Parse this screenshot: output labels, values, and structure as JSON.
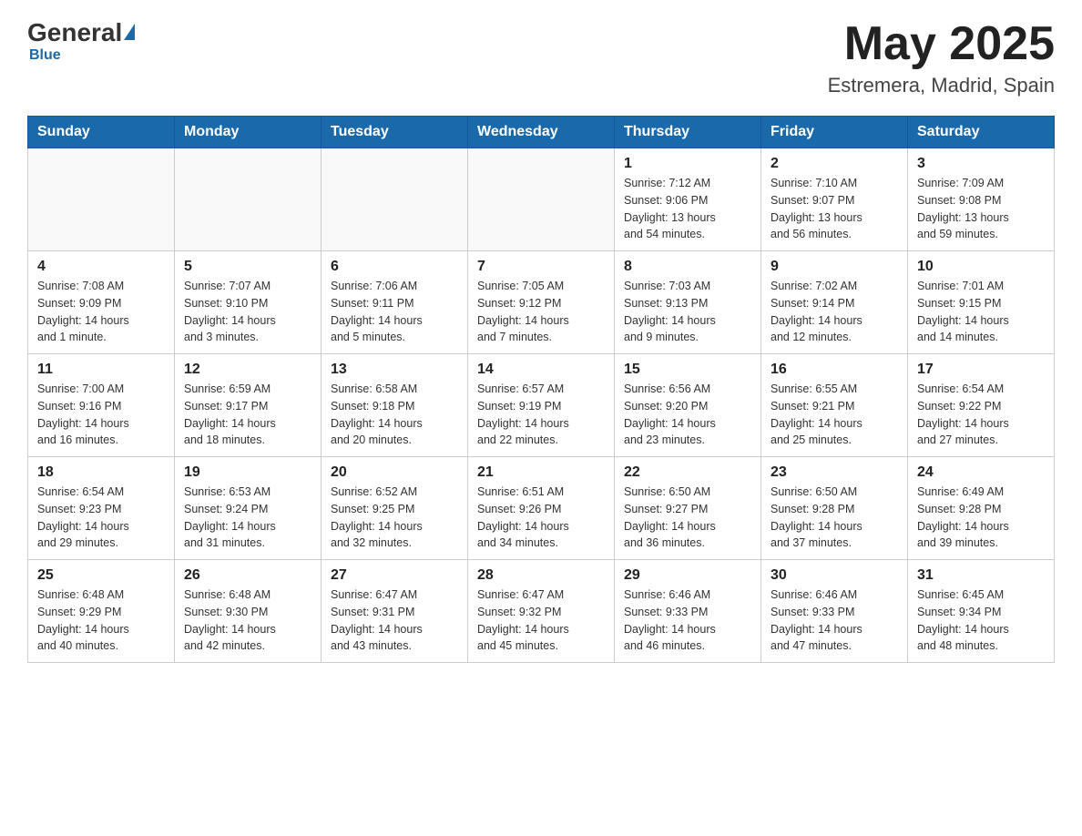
{
  "header": {
    "logo": {
      "general": "General",
      "blue": "Blue",
      "underline": "Blue"
    },
    "title": "May 2025",
    "location": "Estremera, Madrid, Spain"
  },
  "days_of_week": [
    "Sunday",
    "Monday",
    "Tuesday",
    "Wednesday",
    "Thursday",
    "Friday",
    "Saturday"
  ],
  "weeks": [
    [
      {
        "day": "",
        "info": ""
      },
      {
        "day": "",
        "info": ""
      },
      {
        "day": "",
        "info": ""
      },
      {
        "day": "",
        "info": ""
      },
      {
        "day": "1",
        "info": "Sunrise: 7:12 AM\nSunset: 9:06 PM\nDaylight: 13 hours\nand 54 minutes."
      },
      {
        "day": "2",
        "info": "Sunrise: 7:10 AM\nSunset: 9:07 PM\nDaylight: 13 hours\nand 56 minutes."
      },
      {
        "day": "3",
        "info": "Sunrise: 7:09 AM\nSunset: 9:08 PM\nDaylight: 13 hours\nand 59 minutes."
      }
    ],
    [
      {
        "day": "4",
        "info": "Sunrise: 7:08 AM\nSunset: 9:09 PM\nDaylight: 14 hours\nand 1 minute."
      },
      {
        "day": "5",
        "info": "Sunrise: 7:07 AM\nSunset: 9:10 PM\nDaylight: 14 hours\nand 3 minutes."
      },
      {
        "day": "6",
        "info": "Sunrise: 7:06 AM\nSunset: 9:11 PM\nDaylight: 14 hours\nand 5 minutes."
      },
      {
        "day": "7",
        "info": "Sunrise: 7:05 AM\nSunset: 9:12 PM\nDaylight: 14 hours\nand 7 minutes."
      },
      {
        "day": "8",
        "info": "Sunrise: 7:03 AM\nSunset: 9:13 PM\nDaylight: 14 hours\nand 9 minutes."
      },
      {
        "day": "9",
        "info": "Sunrise: 7:02 AM\nSunset: 9:14 PM\nDaylight: 14 hours\nand 12 minutes."
      },
      {
        "day": "10",
        "info": "Sunrise: 7:01 AM\nSunset: 9:15 PM\nDaylight: 14 hours\nand 14 minutes."
      }
    ],
    [
      {
        "day": "11",
        "info": "Sunrise: 7:00 AM\nSunset: 9:16 PM\nDaylight: 14 hours\nand 16 minutes."
      },
      {
        "day": "12",
        "info": "Sunrise: 6:59 AM\nSunset: 9:17 PM\nDaylight: 14 hours\nand 18 minutes."
      },
      {
        "day": "13",
        "info": "Sunrise: 6:58 AM\nSunset: 9:18 PM\nDaylight: 14 hours\nand 20 minutes."
      },
      {
        "day": "14",
        "info": "Sunrise: 6:57 AM\nSunset: 9:19 PM\nDaylight: 14 hours\nand 22 minutes."
      },
      {
        "day": "15",
        "info": "Sunrise: 6:56 AM\nSunset: 9:20 PM\nDaylight: 14 hours\nand 23 minutes."
      },
      {
        "day": "16",
        "info": "Sunrise: 6:55 AM\nSunset: 9:21 PM\nDaylight: 14 hours\nand 25 minutes."
      },
      {
        "day": "17",
        "info": "Sunrise: 6:54 AM\nSunset: 9:22 PM\nDaylight: 14 hours\nand 27 minutes."
      }
    ],
    [
      {
        "day": "18",
        "info": "Sunrise: 6:54 AM\nSunset: 9:23 PM\nDaylight: 14 hours\nand 29 minutes."
      },
      {
        "day": "19",
        "info": "Sunrise: 6:53 AM\nSunset: 9:24 PM\nDaylight: 14 hours\nand 31 minutes."
      },
      {
        "day": "20",
        "info": "Sunrise: 6:52 AM\nSunset: 9:25 PM\nDaylight: 14 hours\nand 32 minutes."
      },
      {
        "day": "21",
        "info": "Sunrise: 6:51 AM\nSunset: 9:26 PM\nDaylight: 14 hours\nand 34 minutes."
      },
      {
        "day": "22",
        "info": "Sunrise: 6:50 AM\nSunset: 9:27 PM\nDaylight: 14 hours\nand 36 minutes."
      },
      {
        "day": "23",
        "info": "Sunrise: 6:50 AM\nSunset: 9:28 PM\nDaylight: 14 hours\nand 37 minutes."
      },
      {
        "day": "24",
        "info": "Sunrise: 6:49 AM\nSunset: 9:28 PM\nDaylight: 14 hours\nand 39 minutes."
      }
    ],
    [
      {
        "day": "25",
        "info": "Sunrise: 6:48 AM\nSunset: 9:29 PM\nDaylight: 14 hours\nand 40 minutes."
      },
      {
        "day": "26",
        "info": "Sunrise: 6:48 AM\nSunset: 9:30 PM\nDaylight: 14 hours\nand 42 minutes."
      },
      {
        "day": "27",
        "info": "Sunrise: 6:47 AM\nSunset: 9:31 PM\nDaylight: 14 hours\nand 43 minutes."
      },
      {
        "day": "28",
        "info": "Sunrise: 6:47 AM\nSunset: 9:32 PM\nDaylight: 14 hours\nand 45 minutes."
      },
      {
        "day": "29",
        "info": "Sunrise: 6:46 AM\nSunset: 9:33 PM\nDaylight: 14 hours\nand 46 minutes."
      },
      {
        "day": "30",
        "info": "Sunrise: 6:46 AM\nSunset: 9:33 PM\nDaylight: 14 hours\nand 47 minutes."
      },
      {
        "day": "31",
        "info": "Sunrise: 6:45 AM\nSunset: 9:34 PM\nDaylight: 14 hours\nand 48 minutes."
      }
    ]
  ]
}
